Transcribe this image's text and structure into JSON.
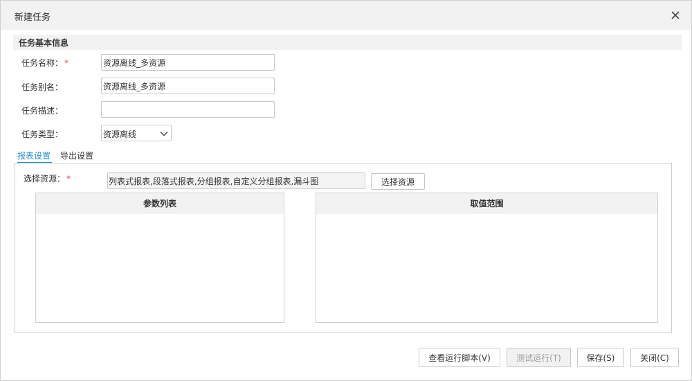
{
  "dialog": {
    "title": "新建任务",
    "close_icon": "close-icon"
  },
  "basic_info": {
    "section_title": "任务基本信息",
    "name_label": "任务名称：",
    "name_required": "*",
    "name_value": "资源离线_多资源",
    "alias_label": "任务别名：",
    "alias_value": "资源离线_多资源",
    "desc_label": "任务描述：",
    "desc_value": "",
    "type_label": "任务类型：",
    "type_value": "资源离线"
  },
  "tabs": [
    {
      "label": "报表设置",
      "active": true
    },
    {
      "label": "导出设置",
      "active": false
    }
  ],
  "report_settings": {
    "resource_label": "选择资源：",
    "resource_required": "*",
    "resource_value": "列表式报表,段落式报表,分组报表,自定义分组报表,漏斗图",
    "choose_button": "选择资源",
    "param_list_header": "参数列表",
    "value_range_header": "取值范围"
  },
  "footer": {
    "view_script": "查看运行脚本(V)",
    "test_run": "测试运行(T)",
    "save": "保存(S)",
    "close": "关闭(C)"
  },
  "colors": {
    "accent": "#1e8cd6",
    "required": "#e04545",
    "header_bg": "#f2f2f2",
    "border": "#cfcfcf"
  }
}
